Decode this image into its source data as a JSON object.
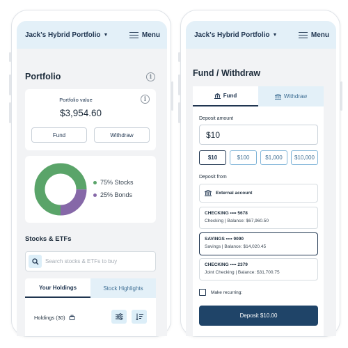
{
  "portfolio_name": "Jack's Hybrid Portfolio",
  "menu_label": "Menu",
  "left": {
    "page_title": "Portfolio",
    "value_label": "Portfolio value",
    "value": "$3,954.60",
    "fund_label": "Fund",
    "withdraw_label": "Withdraw",
    "allocation": [
      {
        "label": "75% Stocks",
        "percent": 75,
        "color": "#5aa469"
      },
      {
        "label": "25% Bonds",
        "percent": 25,
        "color": "#8668a8"
      }
    ],
    "section_title": "Stocks & ETFs",
    "search_placeholder": "Search stocks & ETFs to buy",
    "tabs": [
      "Your Holdings",
      "Stock Highlights"
    ],
    "holdings_label": "Holdings (30)"
  },
  "right": {
    "page_title": "Fund / Withdraw",
    "tabs": [
      "Fund",
      "Withdraw"
    ],
    "deposit_amount_label": "Deposit amount",
    "deposit_amount_value": "$10",
    "amount_options": [
      "$10",
      "$100",
      "$1,000",
      "$10,000"
    ],
    "deposit_from_label": "Deposit from",
    "external_account_label": "External account",
    "accounts": [
      {
        "name": "CHECKING  •••• 5678",
        "detail": "Checking | Balance: $67,960.50",
        "selected": false
      },
      {
        "name": "SAVINGS  •••• 9090",
        "detail": "Savings | Balance: $14,020.45",
        "selected": true
      },
      {
        "name": "CHECKING  •••• 2379",
        "detail": "Joint Checking | Balance: $31,700.75",
        "selected": false
      }
    ],
    "recurring_label": "Make recurring:",
    "deposit_button": "Deposit $10.00"
  },
  "colors": {
    "navy": "#1f3550",
    "accent_light": "#e3f0f8",
    "stocks": "#5aa469",
    "bonds": "#8668a8"
  }
}
